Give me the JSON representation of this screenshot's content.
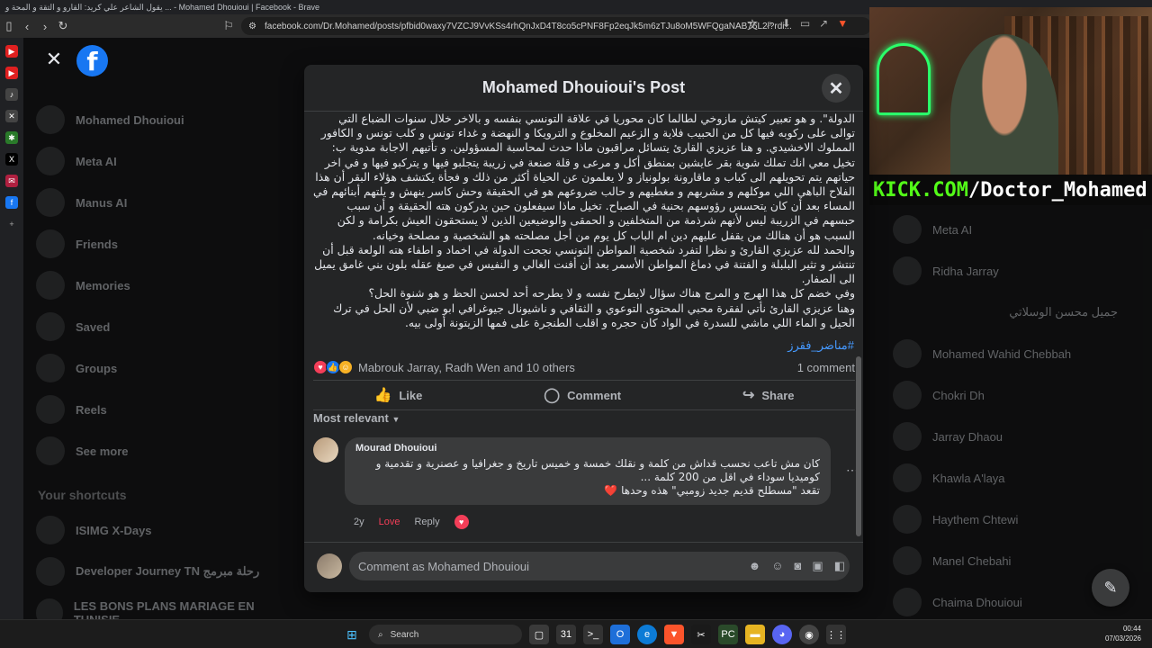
{
  "browser": {
    "window_title": "يقول الشاعر علي كريد: القارو و التقة و المحة و ... - Mohamed Dhouioui | Facebook - Brave",
    "url": "facebook.com/Dr.Mohamed/posts/pfbid0waxy7VZCJ9VvKSs4rhQnJxD4T8co5cPNF8Fp2eqJk5m6zTJu8oM5WFQgaNAB76L2l?rdi..."
  },
  "left_nav": {
    "items": [
      {
        "label": "Mohamed Dhouioui"
      },
      {
        "label": "Meta AI"
      },
      {
        "label": "Manus AI"
      },
      {
        "label": "Friends"
      },
      {
        "label": "Memories"
      },
      {
        "label": "Saved"
      },
      {
        "label": "Groups"
      },
      {
        "label": "Reels"
      },
      {
        "label": "See more"
      }
    ],
    "shortcuts_title": "Your shortcuts",
    "shortcuts": [
      {
        "label": "ISIMG X-Days"
      },
      {
        "label": "Developer Journey TN رحلة مبرمج"
      },
      {
        "label": "LES BONS PLANS MARIAGE EN TUNISIE"
      }
    ]
  },
  "contacts": [
    {
      "label": "Meta AI"
    },
    {
      "label": "Ridha Jarray"
    },
    {
      "label": "جميل محسن الوسلاتي",
      "rtl": true
    },
    {
      "label": "Mohamed Wahid Chebbah"
    },
    {
      "label": "Chokri Dh"
    },
    {
      "label": "Jarray Dhaou"
    },
    {
      "label": "Khawla A'laya"
    },
    {
      "label": "Haythem Chtewi"
    },
    {
      "label": "Manel Chebahi"
    },
    {
      "label": "Chaima Dhouioui"
    }
  ],
  "webcam": {
    "banner_prefix": "KICK.COM",
    "banner_rest": "/Doctor_Mohamed"
  },
  "modal": {
    "title": "Mohamed Dhouioui's Post",
    "post_paragraphs": [
      "الدولة\". و هو تعبير كيتش مازوخي لطالما كان محوريا في علاقة التونسي بنفسه و بالاخر خلال سنوات الضباع التي توالى على ركوبه فيها كل من الحبيب فلاية و الزعيم المخلوع و الترويكا و النهضة و غداء تونس و كلب تونس و الكافور المملوك الاخشيدي. و هنا عزيزي القارئ يتسائل مراقبون ماذا حدث لمحاسبة المسؤولين. و تأتيهم الاجابة مدوية ب: تخيل معي انك تملك شوية بقر عايشين بمنطق أكل و مرعى و قلة صنعة في زريبة يتجلبو فيها و يتركبو فيها و في اخر حياتهم يتم تحويلهم الى كباب و ماقارونة بولونياز و لا يعلمون عن الحياة أكثر من ذلك و فجأة يكتشف هؤلاء البقر أن هذا الفلاح الباهي اللي موكلهم و مشربهم و مغطيهم و حالب ضروعهم هو في الحقيقة وحش كاسر ينهش و يلتهم أبنائهم في المساء بعد أن كان يتحسس رؤوسهم بحنية في الصباح. تخيل ماذا سيفعلون حين يدركون هته الحقيقة و أن سبب حبسهم في الزريبة ليس لأنهم شرذمة من المتخلفين و الحمقى والوضيعين الذين لا يستحقون العيش بكرامة و لكن السبب هو أن هنالك من يقفل عليهم دين ام الباب كل يوم من أجل مصلحته هو الشخصية و مصلحة وخيانه.",
      "والحمد لله عزيزي القارئ و نظرا لتفرد شخصية المواطن التونسي نجحت الدولة في اخماد و اطفاء هته الولعة قبل أن تنتشر و تثير البلبلة و الفتنة في دماغ المواطن الأسمر بعد أن أفنت الغالي و النفيس في صبغ عقله بلون بني غامق يميل الى الصفار.",
      "وفي خضم كل هذا الهرج و المرج هناك سؤال لايطرح نفسه و لا يطرحه أحد لحسن الحظ و هو شنوة الحل؟",
      "وهنا عزيزي القارئ نأتي لفقرة محبي المحتوى التوعوي و الثقافي و ناشيونال جيوغرافي ابو ضبي لأن الحل في ترك الحيل و الماء اللي ماشي للسدرة في الواد كان حجره و اقلب الطنجرة على فمها الزيتونة أولى بيه."
    ],
    "hashtag": "#مناضر_فقرز",
    "reactions_text": "Mabrouk Jarray, Radh Wen and 10 others",
    "comments_count": "1 comment",
    "actions": {
      "like": "Like",
      "comment": "Comment",
      "share": "Share"
    },
    "sort_label": "Most relevant",
    "comment": {
      "author": "Mourad Dhouioui",
      "lines": [
        "كان مش تاعب نحسب قداش من كلمة و نقلك خمسة و خميس تاريخ و جغرافيا و عصنرية و تقدمية و",
        "كوميديا سوداء في اقل من 200 كلمة ...",
        "تقعد \"مسطلح قديم جديد زومبي\" هذه وحدها ❤️"
      ],
      "age": "2y",
      "reaction_label": "Love",
      "reply_label": "Reply"
    },
    "composer_placeholder": "Comment as Mohamed Dhouioui"
  },
  "taskbar": {
    "search_label": "Search",
    "time": "00:44",
    "date": "07/03/2026"
  },
  "colors": {
    "fb_blue": "#1877f2",
    "kick_green": "#53fc18",
    "love_red": "#f33e58",
    "hashtag_blue": "#4599ff"
  }
}
